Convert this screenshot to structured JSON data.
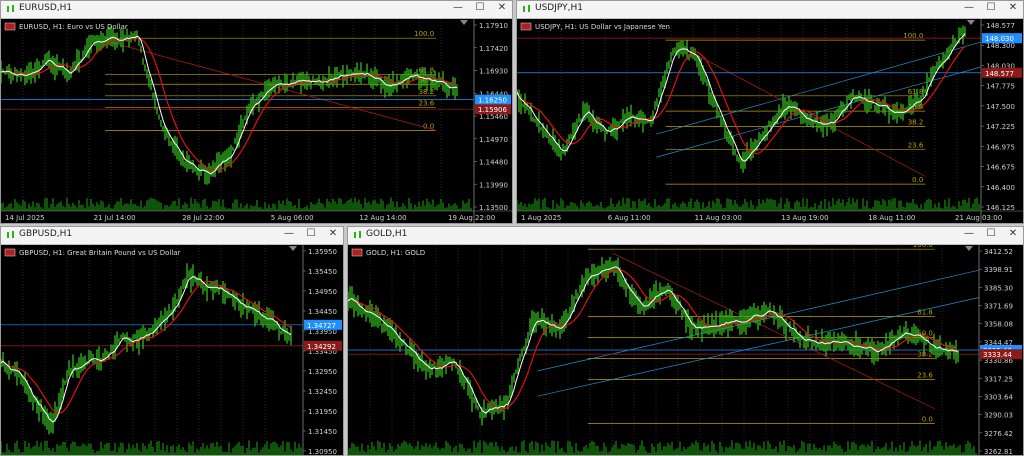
{
  "windows": [
    {
      "id": "w1",
      "title": "EURUSD,H1",
      "symbol_desc": "EURUSD, H1:  Euro vs US Dollar",
      "prices": [
        "1.17910",
        "1.17420",
        "1.16930",
        "1.16440",
        "1.15460",
        "1.14970",
        "1.14480",
        "1.13990",
        "1.13500"
      ],
      "badges": [
        {
          "text": "1.16250",
          "color": "#1e90ff"
        },
        {
          "text": "1.15906",
          "color": "#8b1a1a"
        }
      ],
      "fib": [
        "100.0",
        "61.8",
        "50.0",
        "38.2",
        "23.6",
        "0.0"
      ],
      "dates": [
        "14 Jul 2025",
        "21 Jul 14:00",
        "28 Jul 22:00",
        "5 Aug 06:00",
        "12 Aug 14:00",
        "19 Aug 22:00"
      ]
    },
    {
      "id": "w2",
      "title": "USDJPY,H1",
      "symbol_desc": "USDJPY, H1:  US Dollar vs Japanese Yen",
      "prices": [
        "148.577",
        "148.300",
        "148.030",
        "147.775",
        "147.500",
        "147.225",
        "146.975",
        "146.675",
        "146.400",
        "146.125"
      ],
      "badges": [
        {
          "text": "148.577",
          "color": "#8b1a1a"
        },
        {
          "text": "148.030",
          "color": "#1e90ff"
        }
      ],
      "fib": [
        "100.0",
        "61.8",
        "50.0",
        "38.2",
        "23.6",
        "0.0"
      ],
      "dates": [
        "1 Aug 2025",
        "6 Aug 11:00",
        "11 Aug 03:00",
        "13 Aug 19:00",
        "18 Aug 11:00",
        "21 Aug 03:00"
      ]
    },
    {
      "id": "w3",
      "title": "GBPUSD,H1",
      "symbol_desc": "GBPUSD, H1:  Great Britain Pound vs US Dollar",
      "prices": [
        "1.35950",
        "1.35450",
        "1.34950",
        "1.34450",
        "1.33950",
        "1.33450",
        "1.32950",
        "1.32450",
        "1.31950",
        "1.31450",
        "1.30950"
      ],
      "badges": [
        {
          "text": "1.34727",
          "color": "#1e90ff"
        },
        {
          "text": "1.34292",
          "color": "#8b1a1a"
        }
      ],
      "fib": [],
      "dates": []
    },
    {
      "id": "w4",
      "title": "GOLD,H1",
      "symbol_desc": "GOLD, H1:  GOLD",
      "prices": [
        "3412.52",
        "3398.91",
        "3385.30",
        "3371.69",
        "3358.08",
        "3344.47",
        "3330.86",
        "3317.25",
        "3303.64",
        "3290.03",
        "3276.42",
        "3262.81"
      ],
      "badges": [
        {
          "text": "3335.40",
          "color": "#1e90ff"
        },
        {
          "text": "3333.44",
          "color": "#8b1a1a"
        }
      ],
      "fib": [
        "100.0",
        "61.8",
        "50.0",
        "38.2",
        "23.6",
        "0.0"
      ],
      "dates": []
    }
  ],
  "colors": {
    "grid": "#3a3a3a",
    "fib": "#b8a000",
    "price_line": "#8b1a1a",
    "bid_line": "#1e90ff",
    "candle": "#2eae1a",
    "ma": "#ffffff",
    "ma_slow": "#e01010",
    "volume": "#1a8a10",
    "axis_text": "#cfcfcf",
    "bg": "#000000"
  },
  "icons": {
    "window_icon": "chart-window-icon",
    "minimize": "minimize-icon",
    "maximize": "maximize-icon",
    "close": "close-icon"
  }
}
